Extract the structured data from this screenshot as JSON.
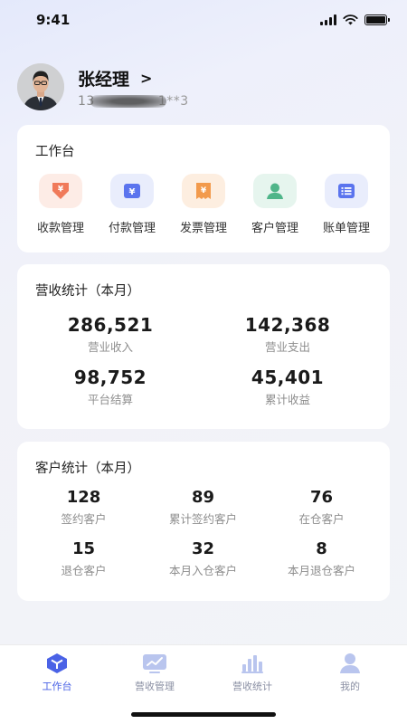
{
  "status_bar": {
    "time": "9:41"
  },
  "profile": {
    "name": "张经理",
    "chevron": ">",
    "phone_prefix": "13",
    "phone_suffix": "1**3"
  },
  "workbench": {
    "title": "工作台",
    "items": [
      {
        "label": "收款管理",
        "icon": "payment-receipt-icon",
        "color": "#f07a5a",
        "bg": "#fdece6"
      },
      {
        "label": "付款管理",
        "icon": "payment-icon",
        "color": "#5b74ee",
        "bg": "#e9edfc"
      },
      {
        "label": "发票管理",
        "icon": "invoice-icon",
        "color": "#f29a4c",
        "bg": "#fdeee0"
      },
      {
        "label": "客户管理",
        "icon": "customer-icon",
        "color": "#4fb589",
        "bg": "#e6f5ee"
      },
      {
        "label": "账单管理",
        "icon": "bill-icon",
        "color": "#5b74ee",
        "bg": "#e9edfc"
      }
    ]
  },
  "revenue": {
    "title": "营收统计（本月）",
    "stats": [
      {
        "value": "286,521",
        "label": "营业收入"
      },
      {
        "value": "142,368",
        "label": "营业支出"
      },
      {
        "value": "98,752",
        "label": "平台结算"
      },
      {
        "value": "45,401",
        "label": "累计收益"
      }
    ]
  },
  "customer": {
    "title": "客户统计（本月）",
    "stats": [
      {
        "value": "128",
        "label": "签约客户"
      },
      {
        "value": "89",
        "label": "累计签约客户"
      },
      {
        "value": "76",
        "label": "在仓客户"
      },
      {
        "value": "15",
        "label": "退仓客户"
      },
      {
        "value": "32",
        "label": "本月入仓客户"
      },
      {
        "value": "8",
        "label": "本月退仓客户"
      }
    ]
  },
  "tabbar": {
    "active_color": "#4a62e6",
    "tabs": [
      {
        "label": "工作台",
        "icon": "workbench-cube-icon",
        "active": true
      },
      {
        "label": "营收管理",
        "icon": "revenue-monitor-icon",
        "active": false
      },
      {
        "label": "营收统计",
        "icon": "bar-chart-icon",
        "active": false
      },
      {
        "label": "我的",
        "icon": "user-icon",
        "active": false
      }
    ]
  }
}
